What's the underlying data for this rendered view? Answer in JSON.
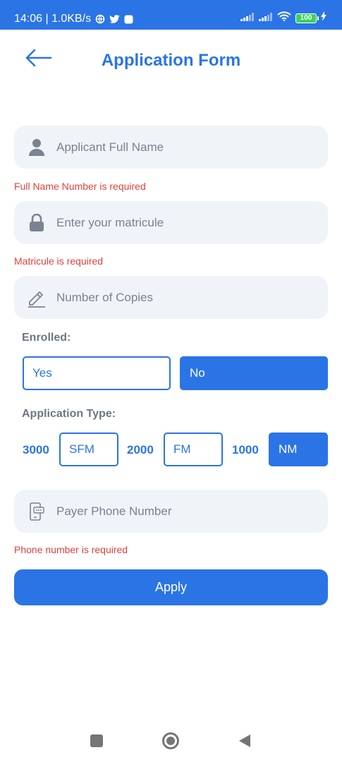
{
  "status_bar": {
    "time_speed": "14:06 | 1.0KB/s",
    "battery": "100"
  },
  "header": {
    "title": "Application Form"
  },
  "fields": {
    "full_name_placeholder": "Applicant Full Name",
    "matricule_placeholder": "Enter your matricule",
    "copies_placeholder": "Number of Copies",
    "phone_placeholder": "Payer Phone Number"
  },
  "errors": {
    "full_name": "Full Name Number is required",
    "matricule": "Matricule is required",
    "phone": "Phone number is required"
  },
  "enrolled": {
    "label": "Enrolled:",
    "yes": "Yes",
    "no": "No",
    "selected": "No"
  },
  "application_type": {
    "label": "Application Type:",
    "options": [
      {
        "price": "3000",
        "code": "SFM"
      },
      {
        "price": "2000",
        "code": "FM"
      },
      {
        "price": "1000",
        "code": "NM"
      }
    ],
    "selected": "NM"
  },
  "apply_label": "Apply",
  "colors": {
    "accent": "#2b74e6",
    "error": "#e0403c",
    "field_bg": "#f0f3f8",
    "label_gray": "#6e7683"
  },
  "icons": {
    "back": "arrow-left-icon",
    "person": "person-icon",
    "lock": "lock-icon",
    "pencil": "pencil-icon",
    "phone": "phone-icon"
  }
}
